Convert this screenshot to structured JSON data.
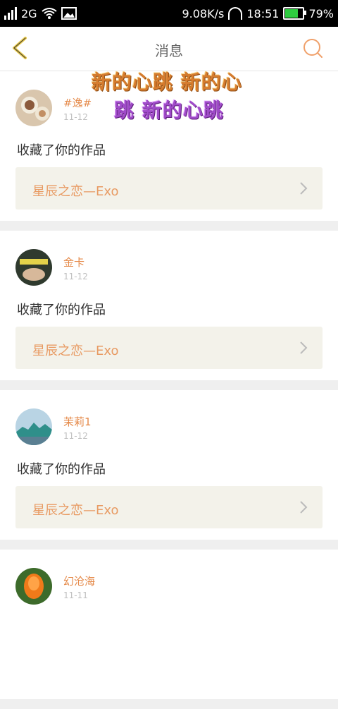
{
  "status": {
    "network": "2G",
    "speed": "9.08K/s",
    "time": "18:51",
    "battery": "79%"
  },
  "header": {
    "title": "消息"
  },
  "overlay": {
    "line1": "新的心跳 新的心",
    "line2": "跳 新的心跳"
  },
  "messages": [
    {
      "username": "#逸#",
      "time": "11-12",
      "action": "收藏了你的作品",
      "work_title": "星辰之恋—Exo"
    },
    {
      "username": "金卡",
      "time": "11-12",
      "action": "收藏了你的作品",
      "work_title": "星辰之恋—Exo"
    },
    {
      "username": "茉莉1",
      "time": "11-12",
      "action": "收藏了你的作品",
      "work_title": "星辰之恋—Exo"
    },
    {
      "username": "幻沧海",
      "time": "11-11",
      "action": "",
      "work_title": ""
    }
  ],
  "colors": {
    "accent": "#e58a4a",
    "back_icon": "#e8c84a"
  }
}
